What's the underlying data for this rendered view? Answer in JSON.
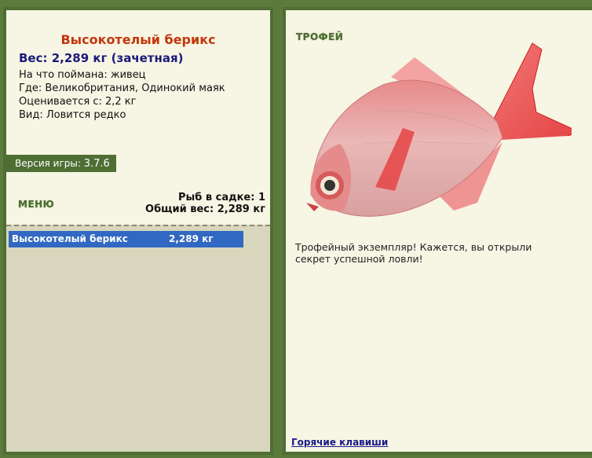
{
  "fish": {
    "name": "Высокотелый берикс",
    "weight_line": "Вес: 2,289 кг (зачетная)",
    "bait_line": "На что поймана: живец",
    "location_line": "Где: Великобритания, Одинокий маяк",
    "rated_line": "Оценивается с: 2,2 кг",
    "rarity_line": "Вид: Ловится редко"
  },
  "version": {
    "label": "Версия игры: ",
    "number": "3.7.6"
  },
  "menu": {
    "label": "МЕНЮ"
  },
  "keepnet": {
    "count_line": "Рыб в садке: 1",
    "total_line": "Общий вес: 2,289 кг"
  },
  "catch_list": [
    {
      "name": "Высокотелый берикс",
      "weight": "2,289 кг"
    }
  ],
  "trophy": {
    "label": "ТРОФЕЙ",
    "description": "Трофейный экземпляр! Кажется, вы открыли секрет успешной ловли!"
  },
  "hotkeys": {
    "label": "Горячие клавиши"
  },
  "colors": {
    "frame": "#4e6e33",
    "panel_bg": "#f7f5e4",
    "title_red": "#c4360c",
    "weight_blue": "#1a1a7a",
    "selection_blue": "#3168c2"
  },
  "icons": {
    "fish_image": "red-fish-picture"
  }
}
